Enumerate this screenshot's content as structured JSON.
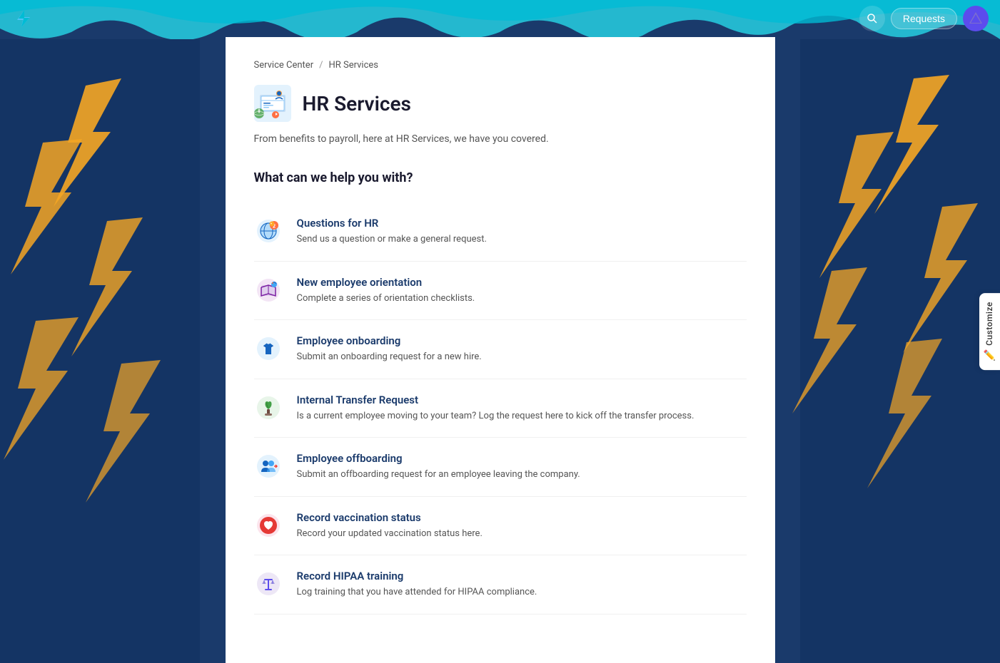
{
  "header": {
    "logo_symbol": "⚡",
    "search_label": "Search",
    "requests_label": "Requests",
    "atlas_label": "A"
  },
  "breadcrumb": {
    "parent": "Service Center",
    "separator": "/",
    "current": "HR Services"
  },
  "page": {
    "title": "HR Services",
    "description": "From benefits to payroll, here at HR Services, we have you covered.",
    "section_heading": "What can we help you with?"
  },
  "services": [
    {
      "id": "questions-hr",
      "icon": "🌐",
      "title": "Questions for HR",
      "description": "Send us a question or make a general request."
    },
    {
      "id": "new-employee-orientation",
      "icon": "🗺️",
      "title": "New employee orientation",
      "description": "Complete a series of orientation checklists."
    },
    {
      "id": "employee-onboarding",
      "icon": "👕",
      "title": "Employee onboarding",
      "description": "Submit an onboarding request for a new hire."
    },
    {
      "id": "internal-transfer",
      "icon": "🌱",
      "title": "Internal Transfer Request",
      "description": "Is a current employee moving to your team? Log the request here to kick off the transfer process."
    },
    {
      "id": "employee-offboarding",
      "icon": "👥",
      "title": "Employee offboarding",
      "description": "Submit an offboarding request for an employee leaving the company."
    },
    {
      "id": "vaccination-status",
      "icon": "❤️",
      "title": "Record vaccination status",
      "description": "Record your updated vaccination status here."
    },
    {
      "id": "hipaa-training",
      "icon": "⚖️",
      "title": "Record HIPAA training",
      "description": "Log training that you have attended for HIPAA compliance."
    }
  ],
  "customize": {
    "label": "Customize",
    "icon": "✏️"
  },
  "colors": {
    "bg_dark": "#1a3a6b",
    "teal": "#00bcd4",
    "accent": "#5c4ced",
    "lightning_orange": "#f5a623"
  }
}
